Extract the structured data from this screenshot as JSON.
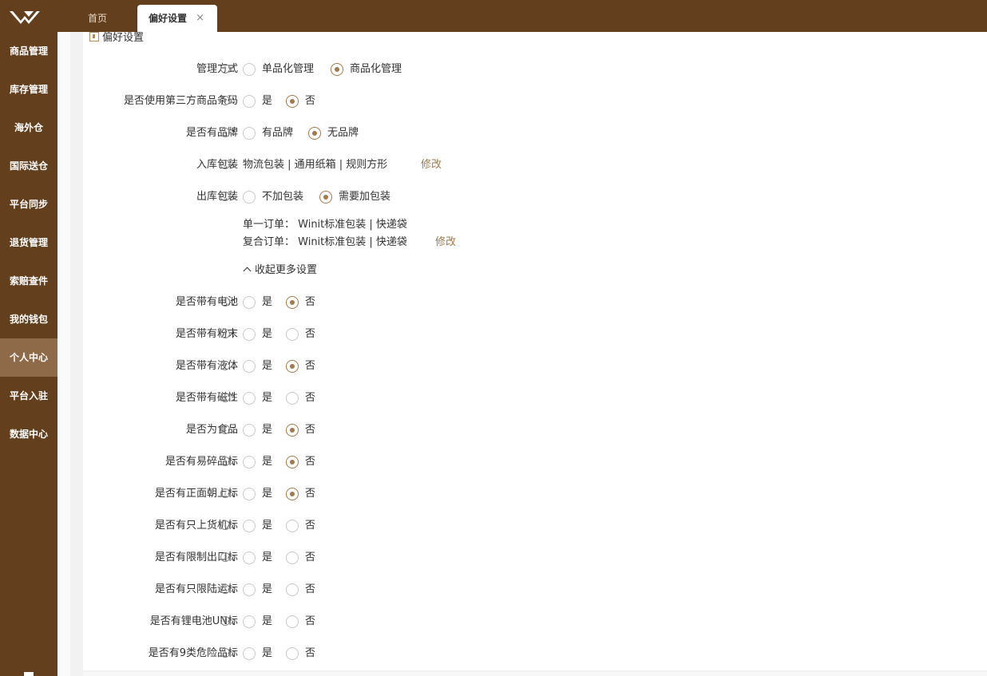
{
  "tabs": {
    "home": "首页",
    "pref": "偏好设置",
    "close": "×"
  },
  "sidebar": [
    "商品管理",
    "库存管理",
    "海外仓",
    "国际送仓",
    "平台同步",
    "退货管理",
    "索赔查件",
    "我的钱包",
    "个人中心",
    "平台入驻",
    "数据中心"
  ],
  "breadcrumb": "偏好设置",
  "info_glyph": "i",
  "colon": ":",
  "settings": {
    "mgmt": {
      "label": "管理方式",
      "opt1": "单品化管理",
      "opt2": "商品化管理",
      "selected": 2
    },
    "barcode": {
      "label": "是否使用第三方商品条码",
      "opt1": "是",
      "opt2": "否",
      "selected": 2
    },
    "brand": {
      "label": "是否有品牌",
      "opt1": "有品牌",
      "opt2": "无品牌",
      "selected": 2
    },
    "inbound": {
      "label": "入库包装",
      "value": "物流包装 | 通用纸箱 | 规则方形",
      "action": "修改"
    },
    "outbound": {
      "label": "出库包装",
      "opt1": "不加包装",
      "opt2": "需要加包装",
      "selected": 2
    },
    "single_order": "单一订单： Winit标准包装 | 快递袋",
    "composite_order": "复合订单： Winit标准包装 | 快递袋",
    "composite_action": "修改",
    "collapse": "收起更多设置",
    "flags": [
      {
        "label": "是否带有电池",
        "yes": "是",
        "no": "否",
        "selected": "no"
      },
      {
        "label": "是否带有粉末",
        "yes": "是",
        "no": "否",
        "selected": "none"
      },
      {
        "label": "是否带有液体",
        "yes": "是",
        "no": "否",
        "selected": "no"
      },
      {
        "label": "是否带有磁性",
        "yes": "是",
        "no": "否",
        "selected": "none"
      },
      {
        "label": "是否为食品",
        "yes": "是",
        "no": "否",
        "selected": "no"
      },
      {
        "label": "是否有易碎品标",
        "yes": "是",
        "no": "否",
        "selected": "no"
      },
      {
        "label": "是否有正面朝上标",
        "yes": "是",
        "no": "否",
        "selected": "no"
      },
      {
        "label": "是否有只上货机标",
        "yes": "是",
        "no": "否",
        "selected": "none"
      },
      {
        "label": "是否有限制出口标",
        "yes": "是",
        "no": "否",
        "selected": "none"
      },
      {
        "label": "是否有只限陆运标",
        "yes": "是",
        "no": "否",
        "selected": "none"
      },
      {
        "label": "是否有锂电池UN标",
        "yes": "是",
        "no": "否",
        "selected": "none"
      },
      {
        "label": "是否有9类危险品标",
        "yes": "是",
        "no": "否",
        "selected": "none"
      }
    ]
  },
  "colors": {
    "brand": "#633f1e",
    "active": "#8e6a48",
    "accent": "#a27a4c"
  }
}
